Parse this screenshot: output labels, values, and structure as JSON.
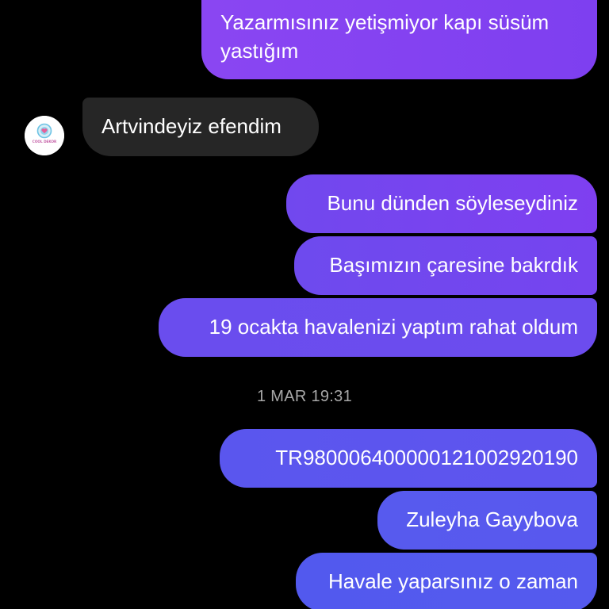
{
  "conversation": {
    "messages": [
      {
        "sender": "me",
        "lines": [
          "Yazarmısınız yetişmiyor kapı süsüm",
          "yastığım"
        ]
      },
      {
        "sender": "them",
        "text": "Artvindeyiz efendim"
      },
      {
        "sender": "me",
        "text": "Bunu dünden söyleseydiniz"
      },
      {
        "sender": "me",
        "text": "Başımızın çaresine bakrdık"
      },
      {
        "sender": "me",
        "text": "19 ocakta havalenizi yaptım rahat oldum"
      },
      {
        "sender": "me",
        "text": "TR980006400000121002920190"
      },
      {
        "sender": "me",
        "text": "Zuleyha Gayybova"
      },
      {
        "sender": "me",
        "text": "Havale yaparsınız o zaman"
      }
    ],
    "timestamp": "1 MAR 19:31"
  },
  "avatar": {
    "icon": "shop-logo-icon",
    "logo_text": "COOL DEKOR"
  },
  "colors": {
    "background": "#000000",
    "incoming_bubble": "#262626",
    "outgoing_top": "#8a46f2",
    "outgoing_bottom": "#555aee",
    "timestamp": "#a8a8a8"
  }
}
